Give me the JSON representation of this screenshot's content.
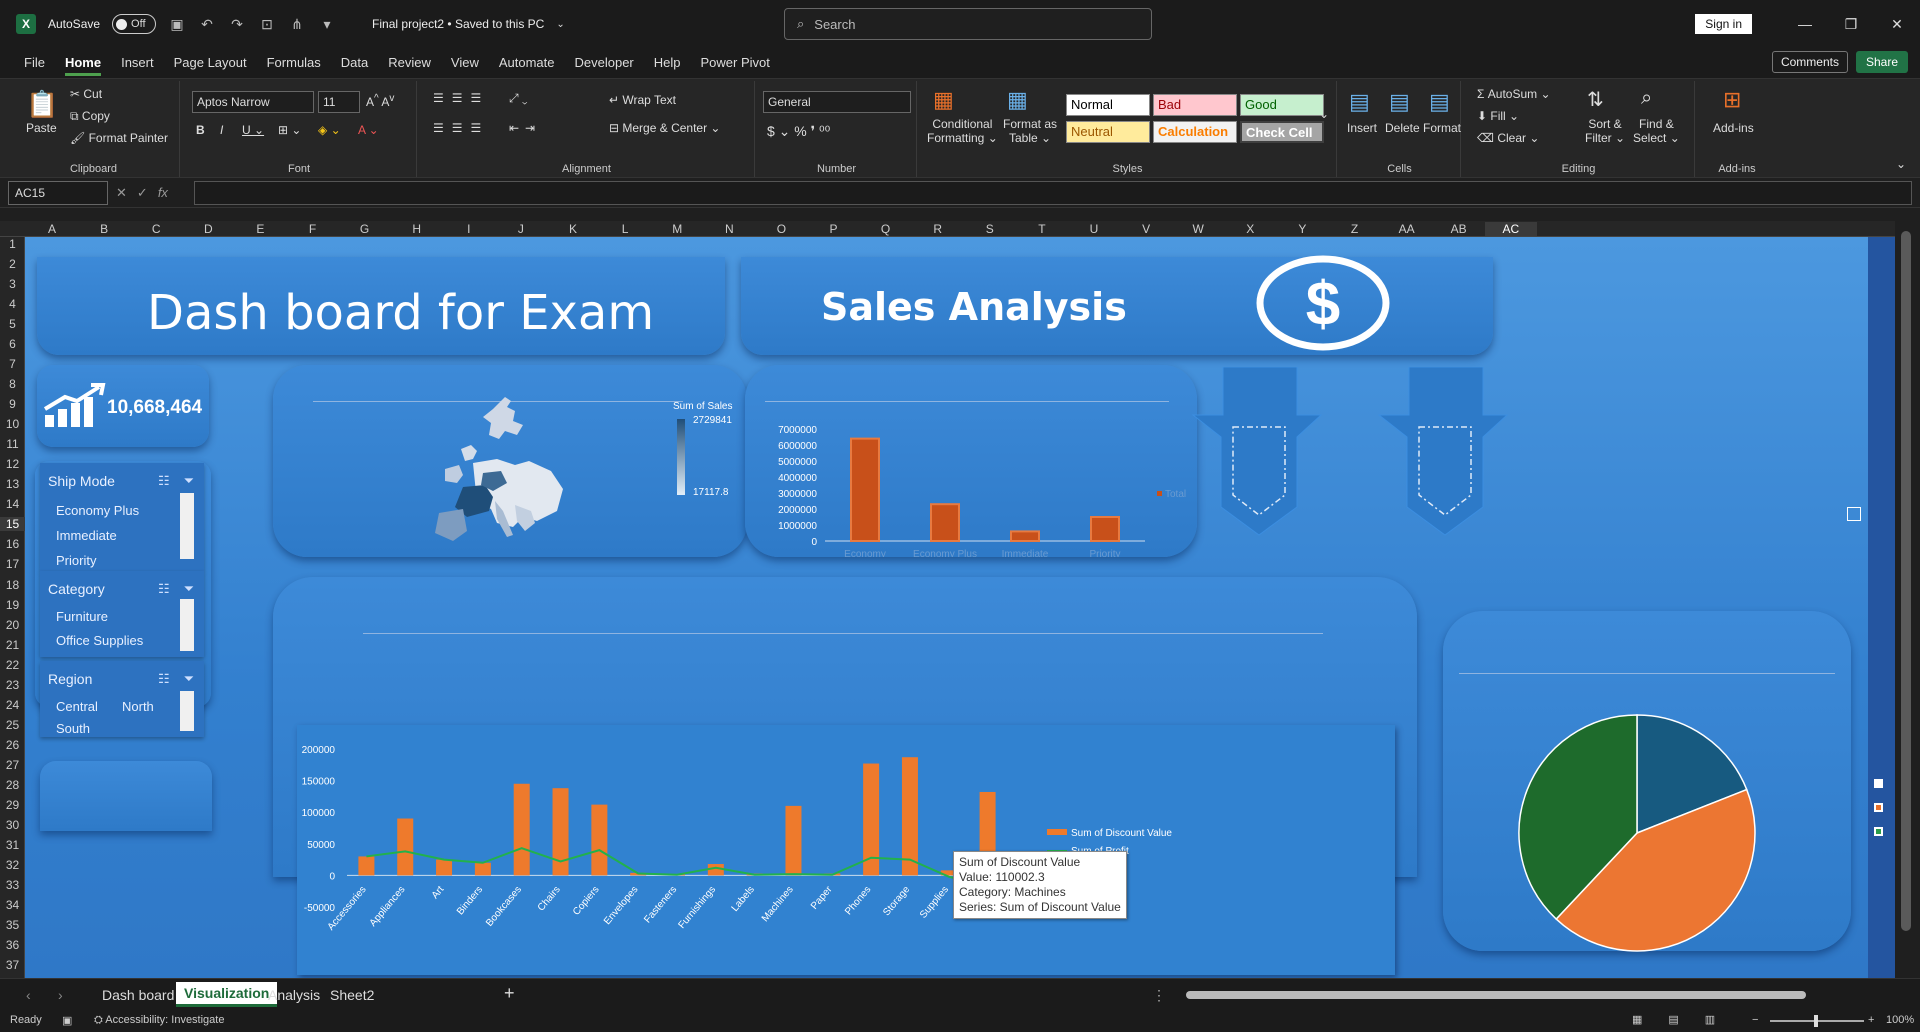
{
  "titlebar": {
    "autosave_label": "AutoSave",
    "autosave_state": "Off",
    "doc_title": "Final project2 • Saved to this PC",
    "search_placeholder": "Search",
    "signin": "Sign in"
  },
  "menu": [
    "File",
    "Home",
    "Insert",
    "Page Layout",
    "Formulas",
    "Data",
    "Review",
    "View",
    "Automate",
    "Developer",
    "Help",
    "Power Pivot"
  ],
  "menu_active": "Home",
  "menu_right": {
    "comments": "Comments",
    "share": "Share"
  },
  "ribbon": {
    "clipboard": {
      "paste": "Paste",
      "cut": "Cut",
      "copy": "Copy",
      "format_painter": "Format Painter",
      "label": "Clipboard"
    },
    "font": {
      "name": "Aptos Narrow",
      "size": "11",
      "label": "Font"
    },
    "alignment": {
      "wrap": "Wrap Text",
      "merge": "Merge & Center",
      "label": "Alignment"
    },
    "number": {
      "format": "General",
      "label": "Number"
    },
    "styles": {
      "cond1": "Conditional",
      "cond2": "Formatting",
      "fmt1": "Format as",
      "fmt2": "Table",
      "normal": "Normal",
      "bad": "Bad",
      "good": "Good",
      "neutral": "Neutral",
      "calculation": "Calculation",
      "check": "Check Cell",
      "label": "Styles"
    },
    "cells": {
      "insert": "Insert",
      "delete": "Delete",
      "format": "Format",
      "label": "Cells"
    },
    "editing": {
      "autosum": "AutoSum",
      "fill": "Fill",
      "clear": "Clear",
      "sort1": "Sort &",
      "sort2": "Filter",
      "find1": "Find &",
      "find2": "Select",
      "label": "Editing"
    },
    "addins": {
      "label1": "Add-ins",
      "label": "Add-ins"
    }
  },
  "formula": {
    "namebox": "AC15",
    "fx": "fx"
  },
  "columns": [
    "A",
    "B",
    "C",
    "D",
    "E",
    "F",
    "G",
    "H",
    "I",
    "J",
    "K",
    "L",
    "M",
    "N",
    "O",
    "P",
    "Q",
    "R",
    "S",
    "T",
    "U",
    "V",
    "W",
    "X",
    "Y",
    "Z",
    "AA",
    "AB",
    "AC"
  ],
  "rows": [
    "1",
    "2",
    "3",
    "4",
    "5",
    "6",
    "7",
    "8",
    "9",
    "10",
    "11",
    "12",
    "13",
    "14",
    "15",
    "16",
    "17",
    "18",
    "19",
    "20",
    "21",
    "22",
    "23",
    "24",
    "25",
    "26",
    "27",
    "28",
    "29",
    "30",
    "31",
    "32",
    "33",
    "34",
    "35",
    "36",
    "37"
  ],
  "dashboard": {
    "title": "Dash board for Exam",
    "subtitle": "Sales Analysis",
    "kpi_value": "10,668,464",
    "slicers": {
      "ship": {
        "title": "Ship Mode",
        "items": [
          "Economy Plus",
          "Immediate",
          "Priority"
        ]
      },
      "category": {
        "title": "Category",
        "items": [
          "Furniture",
          "Office Supplies"
        ]
      },
      "region": {
        "title": "Region",
        "items": [
          "Central",
          "North",
          "South"
        ]
      }
    },
    "map_legend": {
      "title": "Sum of Sales",
      "max": "2729841",
      "min": "17117.8"
    }
  },
  "chart_data": [
    {
      "type": "bar",
      "title": "",
      "categories": [
        "Economy",
        "Economy Plus",
        "Immediate",
        "Priority"
      ],
      "series": [
        {
          "name": "Total",
          "values": [
            6400000,
            2300000,
            600000,
            1500000
          ]
        }
      ],
      "yticks": [
        "7000000",
        "6000000",
        "5000000",
        "4000000",
        "3000000",
        "2000000",
        "1000000",
        "0"
      ],
      "ylim": [
        0,
        7000000
      ]
    },
    {
      "type": "bar",
      "categories": [
        "Accessories",
        "Appliances",
        "Art",
        "Binders",
        "Bookcases",
        "Chairs",
        "Copiers",
        "Envelopes",
        "Fasteners",
        "Furnishings",
        "Labels",
        "Machines",
        "Paper",
        "Phones",
        "Storage",
        "Supplies",
        "Tables"
      ],
      "series": [
        {
          "name": "Sum of Discount Value",
          "type": "bar",
          "values": [
            30000,
            90000,
            25000,
            20000,
            145000,
            138000,
            112000,
            4000,
            2000,
            18000,
            3000,
            110002.3,
            3000,
            177000,
            187000,
            8000,
            132000
          ]
        },
        {
          "name": "Sum of Profit",
          "type": "line",
          "values": [
            30000,
            38000,
            25000,
            20000,
            43000,
            22000,
            40000,
            3000,
            1000,
            12000,
            1000,
            2000,
            1000,
            28000,
            25000,
            -2000,
            -18000
          ]
        }
      ],
      "yticks": [
        "200000",
        "150000",
        "100000",
        "50000",
        "0",
        "-50000"
      ],
      "ylim": [
        -50000,
        200000
      ],
      "tooltip": [
        "Sum of Discount Value",
        "Value: 110002.3",
        "Category: Machines",
        "Series: Sum of Discount Value"
      ]
    },
    {
      "type": "pie",
      "slices": [
        {
          "value": 19,
          "color": "#175a80"
        },
        {
          "value": 43,
          "color": "#ec7632"
        },
        {
          "value": 38,
          "color": "#1e6b2c"
        }
      ]
    }
  ],
  "sheet_tabs": [
    "Dash board",
    "Visualization",
    "Analysis",
    "Sheet2"
  ],
  "sheet_tab_active": "Visualization",
  "status": {
    "ready": "Ready",
    "accessibility": "Accessibility: Investigate",
    "zoom": "100%"
  }
}
